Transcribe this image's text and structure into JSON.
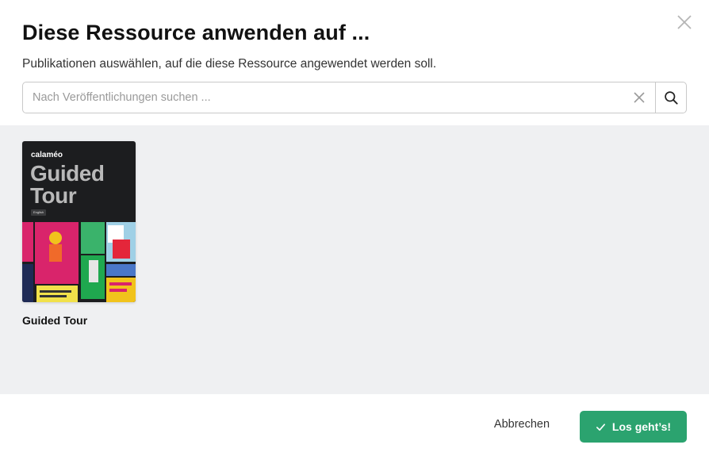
{
  "dialog": {
    "title": "Diese Ressource anwenden auf ...",
    "subtitle": "Publikationen auswählen, auf die diese Ressource angewendet werden soll."
  },
  "search": {
    "placeholder": "Nach Veröffentlichungen suchen ...",
    "value": "",
    "clear_icon": "close-icon",
    "search_icon": "search-icon"
  },
  "publications": [
    {
      "title": "Guided Tour",
      "cover": {
        "brand": "calaméo",
        "title_line1": "Guided",
        "title_line2": "Tour",
        "badge": "English"
      }
    }
  ],
  "footer": {
    "cancel_label": "Abbrechen",
    "confirm_label": "Los geht’s!",
    "confirm_icon": "check-icon"
  },
  "colors": {
    "accent": "#2ba36f",
    "content_bg": "#eff0f2",
    "cover_bg": "#1c1d1f"
  }
}
